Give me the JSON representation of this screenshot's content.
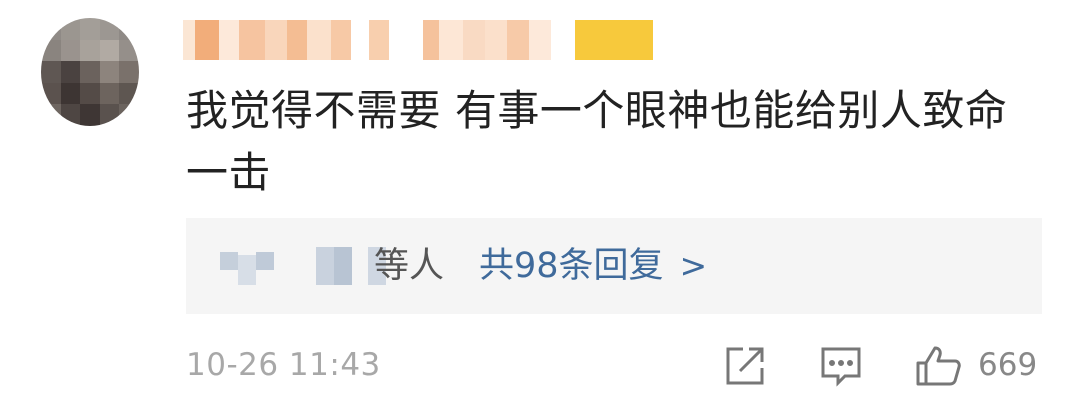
{
  "comment": {
    "text": "我觉得不需要 有事一个眼神也能给别人致命一击",
    "reply_suffix": "等人",
    "reply_link": "共98条回复",
    "reply_chevron": ">",
    "timestamp": "10-26 11:43",
    "like_count": "669"
  },
  "icons": {
    "share": "share-icon",
    "comment": "comment-icon",
    "like": "thumbs-up-icon"
  },
  "colors": {
    "link": "#3f6a9b",
    "text": "#222222",
    "muted": "#a8a8a8",
    "reply_bg": "#f5f5f5"
  }
}
